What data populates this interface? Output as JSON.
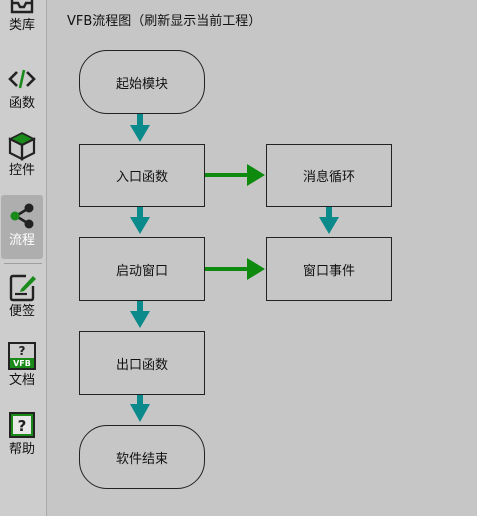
{
  "sidebar": {
    "items": [
      {
        "label": "类库",
        "icon": "library-icon"
      },
      {
        "label": "函数",
        "icon": "code-icon"
      },
      {
        "label": "控件",
        "icon": "cube-icon"
      },
      {
        "label": "流程",
        "icon": "share-icon"
      },
      {
        "label": "便签",
        "icon": "note-icon"
      },
      {
        "label": "文档",
        "icon": "vfb-doc-icon"
      },
      {
        "label": "帮助",
        "icon": "help-icon"
      }
    ],
    "active": "流程",
    "doc_icon_text": "VFB",
    "question_mark": "?"
  },
  "flow": {
    "title": "VFB流程图（刷新显示当前工程）",
    "nodes": {
      "start": "起始模块",
      "entry": "入口函数",
      "msg_loop": "消息循环",
      "start_window": "启动窗口",
      "window_event": "窗口事件",
      "exit_fn": "出口函数",
      "end": "软件结束"
    }
  },
  "colors": {
    "teal_arrow": "#0a8a8a",
    "green_arrow": "#0e8a0e",
    "active_bg": "#aeaeae"
  }
}
